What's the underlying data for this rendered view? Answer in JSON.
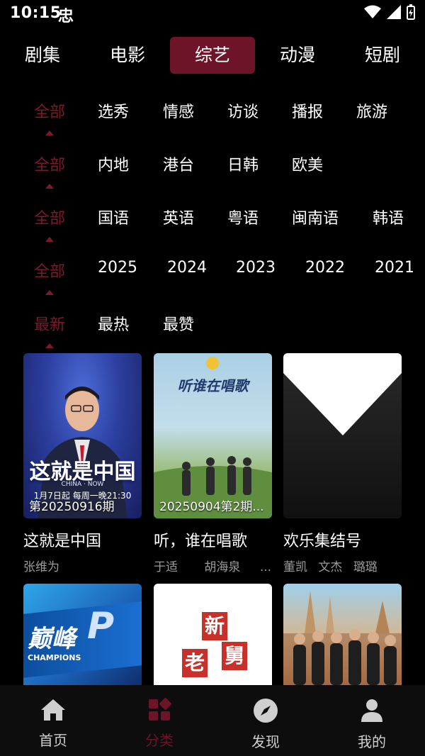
{
  "status": {
    "time": "10:15",
    "app_indicator": "忠"
  },
  "tabs": [
    {
      "label": "剧集"
    },
    {
      "label": "电影"
    },
    {
      "label": "综艺",
      "active": true
    },
    {
      "label": "动漫"
    },
    {
      "label": "短剧"
    }
  ],
  "filters": {
    "genre": [
      "全部",
      "选秀",
      "情感",
      "访谈",
      "播报",
      "旅游"
    ],
    "region": [
      "全部",
      "内地",
      "港台",
      "日韩",
      "欧美"
    ],
    "language": [
      "全部",
      "国语",
      "英语",
      "粤语",
      "闽南语",
      "韩语"
    ],
    "year": [
      "全部",
      "2025",
      "2024",
      "2023",
      "2022",
      "2021"
    ],
    "sort": [
      "最新",
      "最热",
      "最赞"
    ]
  },
  "cards": [
    {
      "title": "这就是中国",
      "episode": "第20250916期",
      "actors": [
        "张维为"
      ],
      "poster_text": "这就是中国",
      "poster_sub": "CHINA · NOW",
      "poster_time": "1月7日起 每周一晚21:30"
    },
    {
      "title": "听，谁在唱歌",
      "episode": "20250904第2期...",
      "actors": [
        "于适",
        "胡海泉",
        "..."
      ],
      "poster_text": "听谁在唱歌"
    },
    {
      "title": "欢乐集结号",
      "episode": "",
      "actors": [
        "董凯",
        "文杰",
        "璐璐"
      ]
    }
  ],
  "row2": [
    {
      "poster_text": "巅峰",
      "poster_sub": "CHAMPIONS"
    },
    {
      "poster_chars": [
        "新",
        "老",
        "舅"
      ]
    },
    {}
  ],
  "nav": [
    {
      "label": "首页",
      "icon": "home-icon"
    },
    {
      "label": "分类",
      "icon": "category-icon",
      "active": true
    },
    {
      "label": "发现",
      "icon": "compass-icon"
    },
    {
      "label": "我的",
      "icon": "user-icon"
    }
  ],
  "colors": {
    "accent": "#6e1428",
    "selected_text": "#7a1a2b",
    "background": "#000000"
  }
}
